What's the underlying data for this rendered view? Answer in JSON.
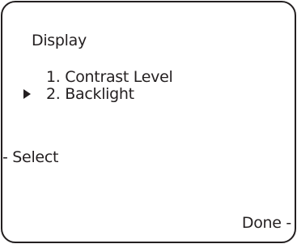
{
  "screen": {
    "title": "Display",
    "menu": {
      "items": [
        {
          "label": "1. Contrast Level",
          "selected": false
        },
        {
          "label": "2. Backlight",
          "selected": true
        }
      ],
      "cursor_icon": "triangle-right-icon"
    },
    "softkeys": {
      "left": "- Select",
      "right": "Done -"
    }
  }
}
